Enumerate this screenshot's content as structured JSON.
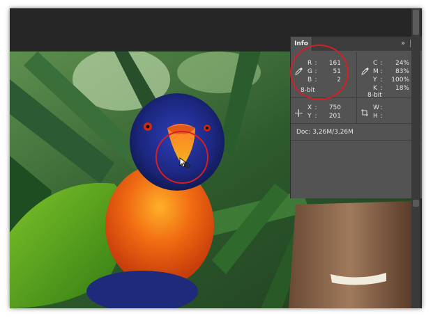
{
  "info_panel": {
    "tab_label": "Info",
    "rgb": {
      "labels": [
        "R",
        "G",
        "B"
      ],
      "values": [
        "161",
        "51",
        "2"
      ],
      "bit_depth": "8-bit",
      "icon": "eyedropper-icon"
    },
    "cmyk": {
      "labels": [
        "C",
        "M",
        "Y",
        "K"
      ],
      "values": [
        "24%",
        "83%",
        "100%",
        "18%"
      ],
      "bit_depth": "8-bit",
      "icon": "eyedropper-icon"
    },
    "position": {
      "labels": [
        "X",
        "Y"
      ],
      "values": [
        "750",
        "201"
      ],
      "icon": "crosshair-icon"
    },
    "size": {
      "labels": [
        "W",
        "H"
      ],
      "values": [
        "",
        ""
      ],
      "icon": "selection-size-icon"
    },
    "doc_size": "Doc: 3,26M/3,26M",
    "colon": ":"
  },
  "colors": {
    "highlight_ring": "#d61f25",
    "panel_bg": "#535353",
    "canvas_bg": "#262626"
  }
}
